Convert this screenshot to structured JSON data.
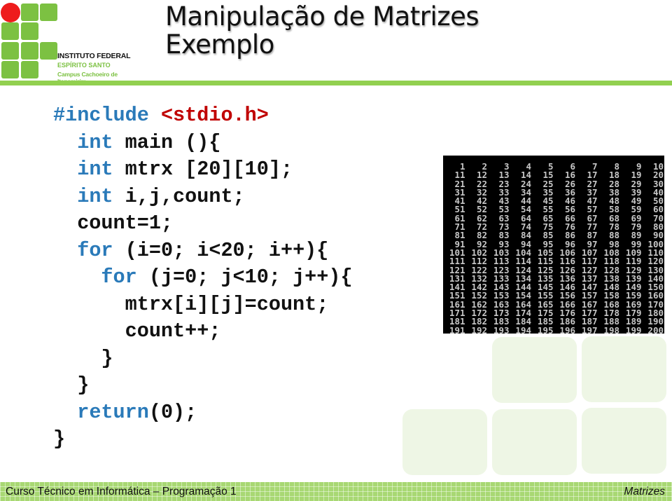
{
  "logo": {
    "institution": "INSTITUTO FEDERAL",
    "state": "ESPÍRITO SANTO",
    "campus": "Campus Cachoeiro de Itapemirim",
    "colors": {
      "green": "#7cc142",
      "red": "#ee1c1c"
    }
  },
  "header": {
    "title_line1": "Manipulação de Matrizes",
    "title_line2": "Exemplo",
    "rule_color": "#92d050"
  },
  "code": {
    "lines": [
      [
        {
          "t": "#include ",
          "c": "kw"
        },
        {
          "t": "<stdio.h>",
          "c": "hdr"
        }
      ],
      [
        {
          "t": "  "
        },
        {
          "t": "int",
          "c": "kw"
        },
        {
          "t": " main (){"
        }
      ],
      [
        {
          "t": "  "
        },
        {
          "t": "int",
          "c": "kw"
        },
        {
          "t": " mtrx [20][10];"
        }
      ],
      [
        {
          "t": "  "
        },
        {
          "t": "int",
          "c": "kw"
        },
        {
          "t": " i,j,count;"
        }
      ],
      [
        {
          "t": "  count=1;"
        }
      ],
      [
        {
          "t": "  "
        },
        {
          "t": "for",
          "c": "kw"
        },
        {
          "t": " (i=0; i<20; i++){"
        }
      ],
      [
        {
          "t": "    "
        },
        {
          "t": "for",
          "c": "kw"
        },
        {
          "t": " (j=0; j<10; j++){"
        }
      ],
      [
        {
          "t": "      mtrx[i][j]=count;"
        }
      ],
      [
        {
          "t": "      count++;"
        }
      ],
      [
        {
          "t": "    }"
        }
      ],
      [
        {
          "t": "  }"
        }
      ],
      [
        {
          "t": "  "
        },
        {
          "t": "return",
          "c": "kw"
        },
        {
          "t": "(0);"
        }
      ],
      [
        {
          "t": "}"
        }
      ]
    ],
    "colors": {
      "keyword": "#2a7ab9",
      "header": "#c00000",
      "text": "#111111"
    }
  },
  "console": {
    "rows": 20,
    "cols": 10,
    "start": 1,
    "background": "#000000",
    "text_color": "#c8c8c8"
  },
  "footer": {
    "course": "Curso Técnico em Informática – Programação 1",
    "topic": "Matrizes"
  }
}
